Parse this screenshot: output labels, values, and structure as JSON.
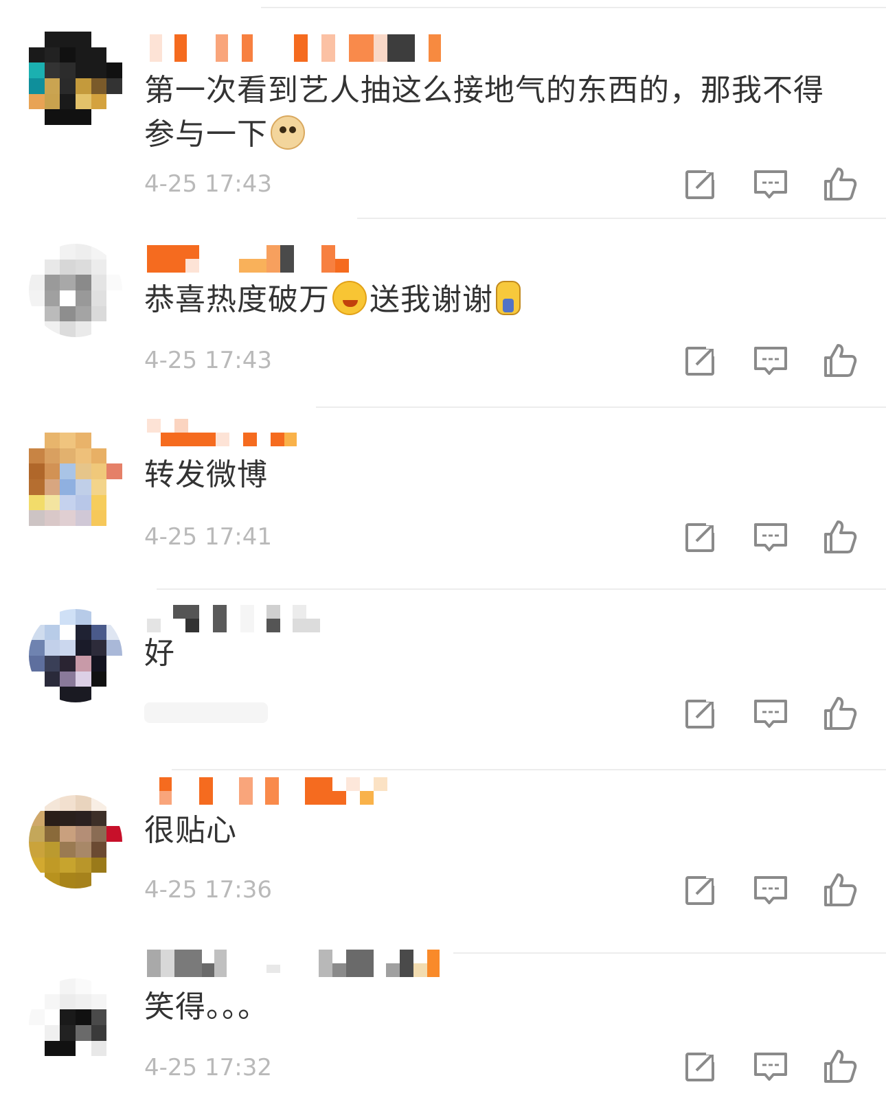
{
  "comments": [
    {
      "text": "第一次看到艺人抽这么接地气的东西的，那我不得参与一下",
      "emoji": "doge",
      "time": "4-25 17:43"
    },
    {
      "text": "恭喜热度破万",
      "emoji": "hug",
      "text2": "送我谢谢",
      "emoji2": "bow",
      "time": "4-25 17:43"
    },
    {
      "text": "转发微博",
      "time": "4-25 17:41"
    },
    {
      "text": "好",
      "time": ""
    },
    {
      "text": "很贴心",
      "time": "4-25 17:36"
    },
    {
      "text": "笑得。。。",
      "time": "4-25 17:32"
    }
  ],
  "icons": {
    "share": "share-icon",
    "reply": "comment-icon",
    "like": "thumbs-up-icon"
  },
  "colors": {
    "text": "#333333",
    "time": "#b9b9b9",
    "icon": "#8a8a8a",
    "divider": "#ececec"
  }
}
